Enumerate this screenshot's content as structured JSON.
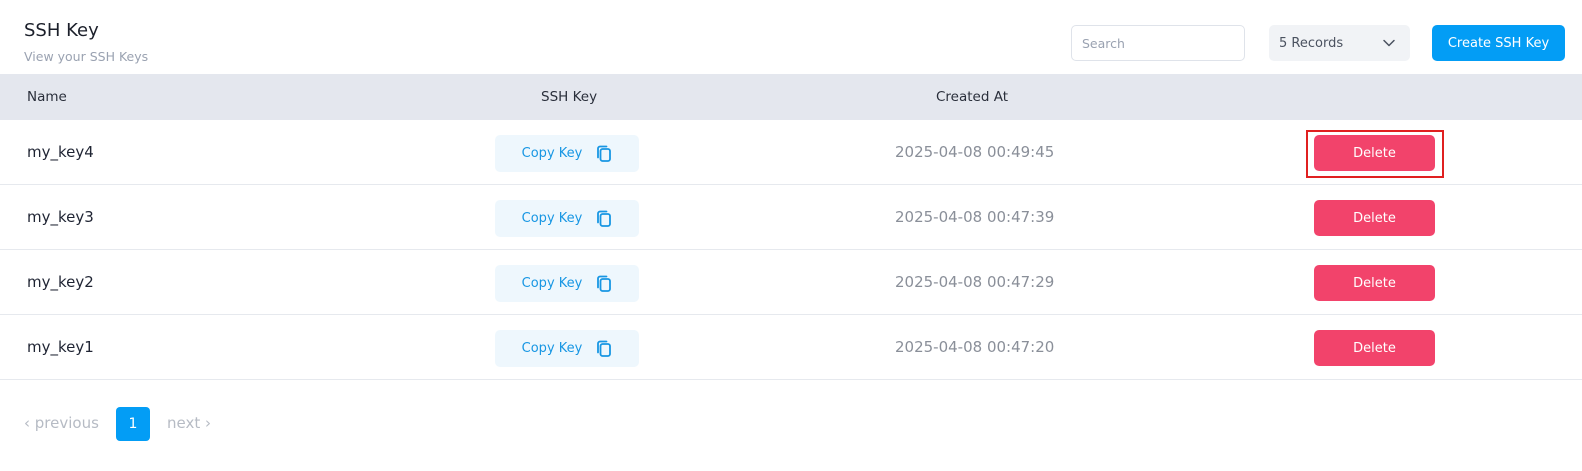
{
  "header": {
    "title": "SSH Key",
    "subtitle": "View your SSH Keys",
    "search_placeholder": "Search",
    "records_select": "5 Records",
    "create_button": "Create SSH Key"
  },
  "table": {
    "columns": [
      "Name",
      "SSH Key",
      "Created At"
    ],
    "copy_label": "Copy Key",
    "delete_label": "Delete",
    "rows": [
      {
        "name": "my_key4",
        "created_at": "2025-04-08 00:49:45"
      },
      {
        "name": "my_key3",
        "created_at": "2025-04-08 00:47:39"
      },
      {
        "name": "my_key2",
        "created_at": "2025-04-08 00:47:29"
      },
      {
        "name": "my_key1",
        "created_at": "2025-04-08 00:47:20"
      }
    ]
  },
  "pagination": {
    "previous": "‹ previous",
    "current_page": "1",
    "next": "next ›"
  },
  "colors": {
    "accent": "#039df5",
    "danger": "#f2436b",
    "highlight_border": "#e02020",
    "table_header_bg": "#e4e7ee"
  },
  "icons": {
    "copy": "copy-icon",
    "dropdown": "chevron-down-icon"
  }
}
